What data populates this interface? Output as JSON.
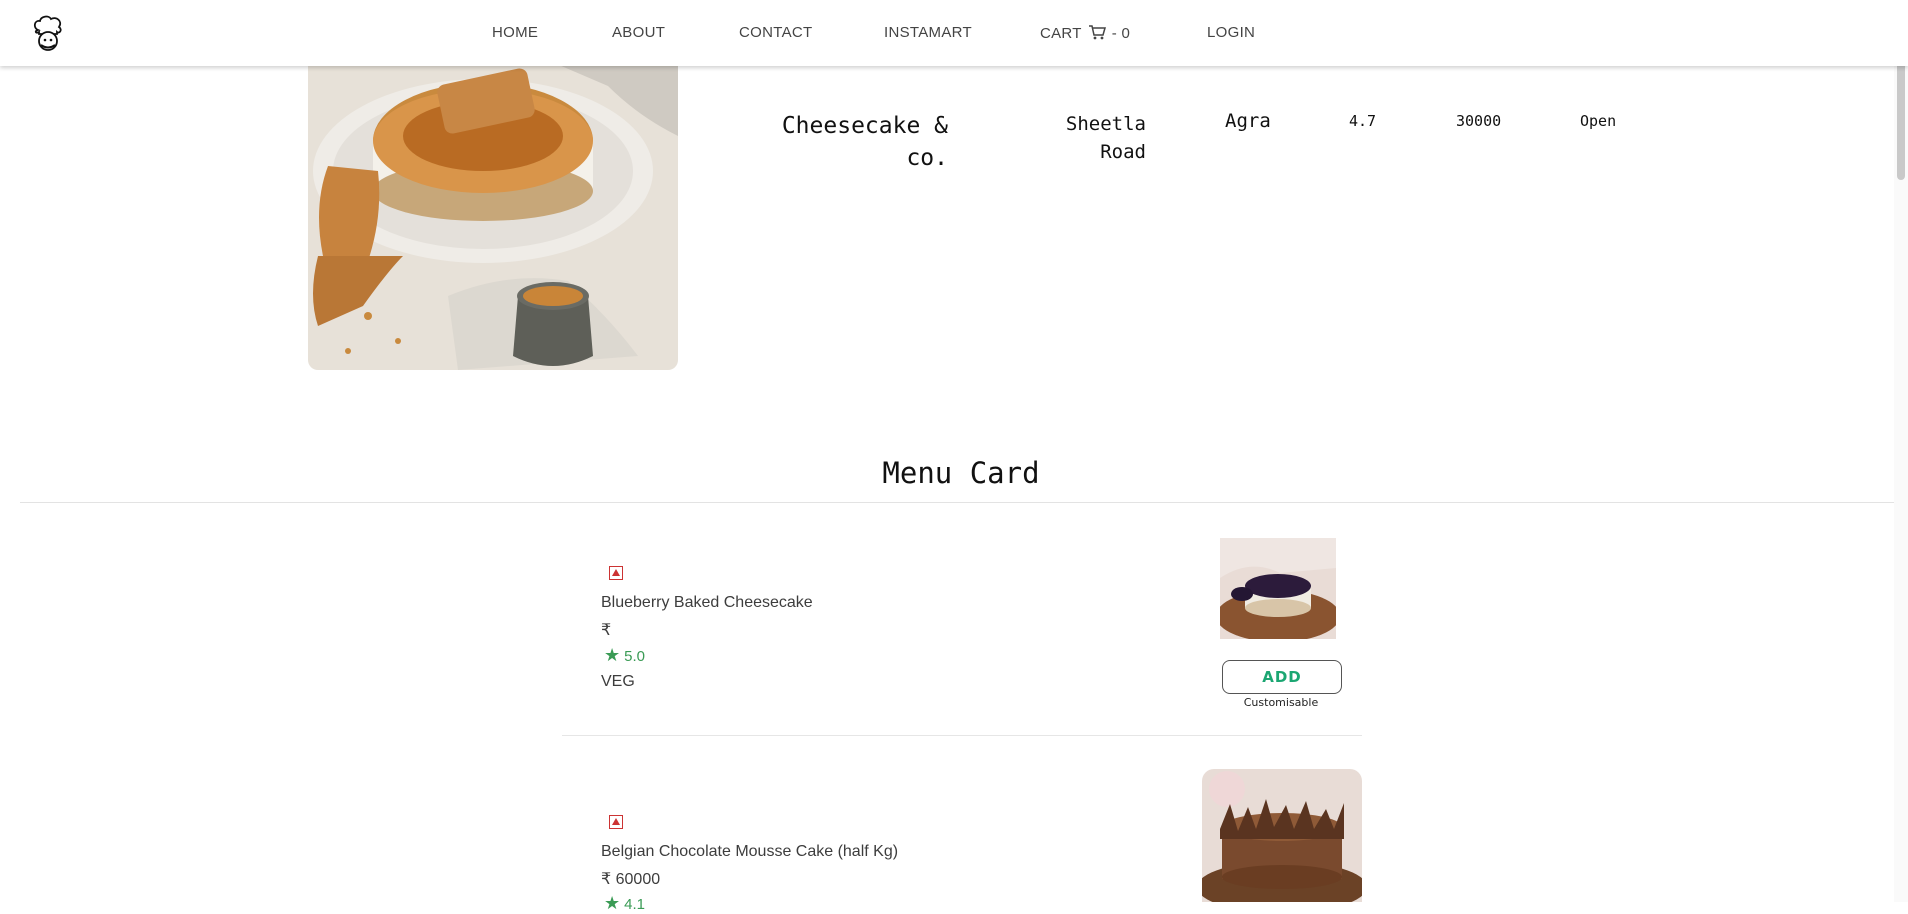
{
  "nav": {
    "home": "HOME",
    "about": "ABOUT",
    "contact": "CONTACT",
    "instamart": "INSTAMART",
    "cart_label": "CART",
    "cart_count": "- 0",
    "login": "LOGIN"
  },
  "restaurant": {
    "name": "Cheesecake & co.",
    "area": "Sheetla Road",
    "city": "Agra",
    "rating": "4.7",
    "cost": "30000",
    "status": "Open"
  },
  "menu": {
    "title": "Menu Card",
    "items": [
      {
        "name": "Blueberry Baked Cheesecake",
        "price": "₹",
        "rating": "5.0",
        "type": "VEG",
        "add_label": "ADD",
        "note": "Customisable"
      },
      {
        "name": "Belgian Chocolate Mousse Cake (half Kg)",
        "price": "₹ 60000",
        "rating": "4.1"
      }
    ]
  },
  "colors": {
    "accent_green": "#1ba672",
    "rating_green": "#3a9b55",
    "veg_mark": "#cc3333"
  }
}
